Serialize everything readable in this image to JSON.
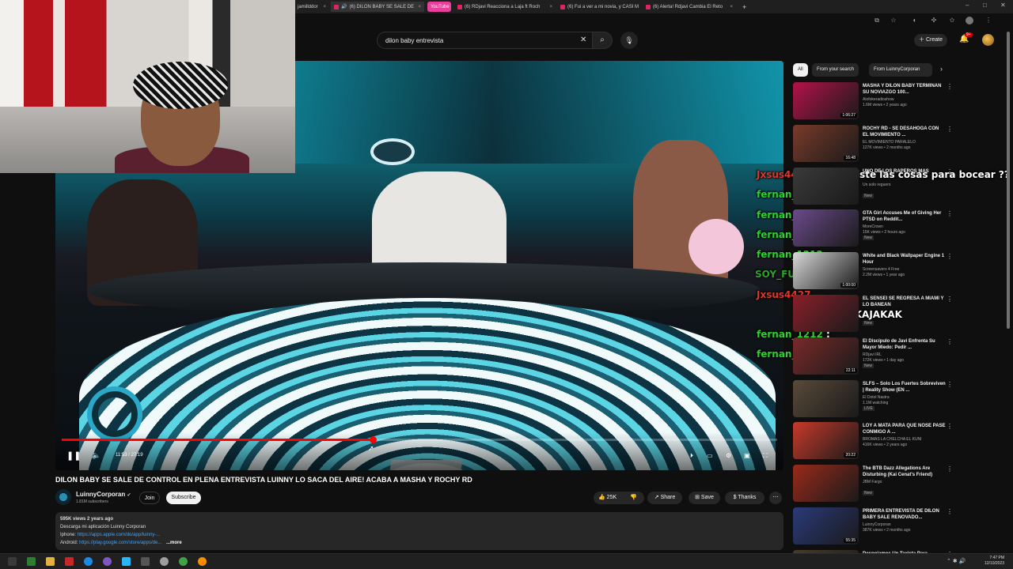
{
  "browser": {
    "tabs": [
      {
        "label": "jamillddor",
        "active": false
      },
      {
        "label": "(6) DILON BABY SE SALE DE",
        "active": true
      },
      {
        "label": "YouTube",
        "active": false
      },
      {
        "label": "(6) RDjavi Reacciona a Laja ft Roch",
        "active": false
      },
      {
        "label": "(6) Fui a ver a mi novia, y CASI M",
        "active": false
      },
      {
        "label": "(6) Alerta! Rdjavi Cambia El Reto",
        "active": false
      }
    ],
    "new_tab": "+",
    "window_controls": [
      "–",
      "□",
      "✕"
    ]
  },
  "youtube": {
    "search_value": "dilon baby entrevista",
    "create_label": "Create",
    "notif_count": "9+"
  },
  "player": {
    "time": "11:53 / 27:19",
    "progress": 0.435,
    "state": "playing"
  },
  "video": {
    "title": "DILON BABY SE SALE DE CONTROL EN PLENA ENTREVISTA LUINNY LO SACA DEL AIRE! ACABA A MASHA Y ROCHY RD",
    "channel": "LuinnyCorporan",
    "subscribers": "1.81M subscribers",
    "join": "Join",
    "subscribe": "Subscribe",
    "likes": "25K",
    "share": "Share",
    "save": "Save",
    "thanks": "Thanks",
    "description": {
      "meta": "595K views  2 years ago",
      "line1": "Descarga mi aplicación Luinny Corporan",
      "iphone_label": "Iphone: ",
      "iphone_link": "https://apps.apple.com/do/app/luinny-...",
      "android_label": "Android: ",
      "android_link": "https://play.google.com/store/apps/de...",
      "more": "...more"
    }
  },
  "chat_overlay": [
    {
      "user": "Jxsus4427",
      "text": " : ya pusiste las cosas para bocear ??"
    },
    {
      "user": "fernan_1212",
      "text": " :"
    },
    {
      "user": "fernan_1212",
      "text": " :"
    },
    {
      "user": "fernan_1212",
      "text": " :"
    },
    {
      "user": "fernan_1212",
      "text": " :"
    },
    {
      "user": "SOY_FURIA",
      "text": ""
    },
    {
      "user": "Jxsus4427",
      "text": ""
    },
    {
      "user": "",
      "text": "JAKAJAKAK"
    },
    {
      "user": "fernan_1212",
      "text": " :"
    },
    {
      "user": "fernan_1212",
      "text": " :"
    }
  ],
  "sidebar": {
    "chips": [
      "All",
      "From your search",
      "From LuinnyCorporan"
    ],
    "videos": [
      {
        "title": "MASHA Y DILON BABY TERMINAN SU NOVIAZGO 100...",
        "channel": "Alofokeradioshow",
        "meta": "1.6M views • 2 years ago",
        "badge": "",
        "duration": "1:06:27",
        "thumb": "#b3124a"
      },
      {
        "title": "ROCHY RD - SE DESAHOGA CON EL MOVIMIENTO ...",
        "channel": "EL MOVIMIENTO PARALELO",
        "meta": "127K views • 2 months ago",
        "badge": "",
        "duration": "16:48",
        "thumb": "#7a3b2a"
      },
      {
        "title": "UNO DE LOS RAPEROS MAS",
        "channel": "Un solo reguero",
        "meta": "",
        "badge": "New",
        "duration": "",
        "thumb": "#3a3a3a"
      },
      {
        "title": "GTA Girl Accuses Me of Giving Her PTSD on Reddit...",
        "channel": "MoreCrown",
        "meta": "15K views • 2 hours ago",
        "badge": "New",
        "duration": "",
        "thumb": "#6a4a8a"
      },
      {
        "title": "White and Black Wallpaper Engine 1 Hour",
        "channel": "Screensavers 4 Free",
        "meta": "2.2M views • 1 year ago",
        "badge": "",
        "duration": "1:00:00",
        "thumb": "#d9d9d9"
      },
      {
        "title": "EL SENSEI SE REGRESA A MIAMI Y LO BANEAN",
        "channel": "",
        "meta": "",
        "badge": "New",
        "duration": "",
        "thumb": "#8a1f2a"
      },
      {
        "title": "El Discípulo de Javi Enfrenta Su Mayor Miedo: Pedir ...",
        "channel": "RDjavi IRL",
        "meta": "172K views • 1 day ago",
        "badge": "New",
        "duration": "22:11",
        "thumb": "#7a2a2a"
      },
      {
        "title": "SLFS – Solo Los Fuertes Sobreviven | Reality Show (EN ...",
        "channel": "El Dotol Nastra",
        "meta": "1.1M watching",
        "badge": "LIVE",
        "duration": "",
        "thumb": "#5a4a3a"
      },
      {
        "title": "LOY A MATA PARA QUE NOSE PASE CONMIGO A ...",
        "channel": "BROMAS LA CHELCHA EL KUNI",
        "meta": "416K views • 2 years ago",
        "badge": "",
        "duration": "20:22",
        "thumb": "#c83a2a"
      },
      {
        "title": "The BTB Dazz Allegations Are Disturbing (Kai Cenat's Friend)",
        "channel": "JBM Fargo",
        "meta": "",
        "badge": "New",
        "duration": "",
        "thumb": "#9a2a1a"
      },
      {
        "title": "PRIMERA ENTREVISTA DE DILON BABY SALE RENOVADO...",
        "channel": "LuinnyCorporan",
        "meta": "387K views • 2 months ago",
        "badge": "",
        "duration": "55:35",
        "thumb": "#2a3a7a"
      },
      {
        "title": "Despojamos Un Taxista Para",
        "channel": "",
        "meta": "",
        "badge": "",
        "duration": "",
        "thumb": "#4a3a2a"
      }
    ]
  },
  "taskbar": {
    "time": "7:47 PM",
    "date": "12/10/2023"
  },
  "colors": {
    "accent_red": "#ff0000",
    "chat_green": "#2dd12d",
    "chat_red": "#e0352b",
    "link_blue": "#3ea6ff"
  }
}
